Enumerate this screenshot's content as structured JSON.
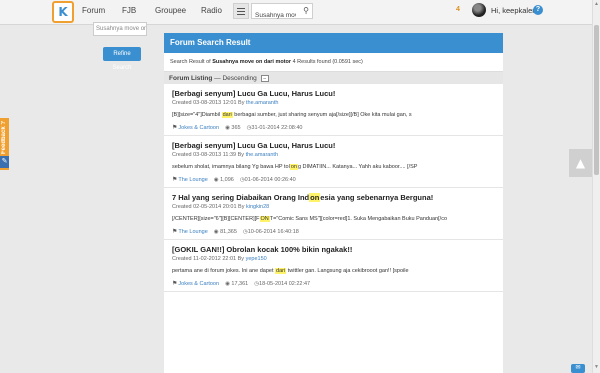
{
  "nav": {
    "logo_glyph": "K",
    "items": [
      "Forum",
      "FJB",
      "Groupee",
      "Radio"
    ],
    "search_value": "Susahnya move",
    "notif_count": "4",
    "greeting": "Hi, keepkalem",
    "help_glyph": "?"
  },
  "refine": {
    "input_value": "Susahnya move on d",
    "button_label": "Refine Search"
  },
  "feedback_label": "Feedback ?",
  "result": {
    "header": "Forum Search Result",
    "info_prefix": "Search Result of ",
    "query": "Susahnya move on dari motor",
    "info_suffix": " 4 Results found (0.0591 sec)",
    "listing_label": "Forum Listing",
    "listing_order": " — Descending"
  },
  "threads": [
    {
      "title": "[Berbagi senyum] Lucu Ga Lucu, Harus Lucu!",
      "created": "Created 03-08-2013 12:01 By ",
      "author": "the.amaranth",
      "snippet_pre": "[B][size=\"4\"]Diambil ",
      "snippet_hl": "dari",
      "snippet_post": " berbagai sumber, just sharing senyum aja[/size][/B] Oke kita mulai gan, s",
      "forum": "Jokes & Cartoon",
      "views": "365",
      "last": "31-01-2014 22:08:40"
    },
    {
      "title": "[Berbagi senyum] Lucu Ga Lucu, Harus Lucu!",
      "created": "Created 03-08-2013 11:39 By ",
      "author": "the.amaranth",
      "snippet_pre": "sebelum sholat, imamnya bilang Yg bawa HP tol",
      "snippet_hl": "on",
      "snippet_post": "g DIMATIIN... Katanya... Yahh aku kaboor.... [/SP",
      "forum": "The Lounge",
      "views": "1,096",
      "last": "01-06-2014 00:26:40"
    },
    {
      "title": "7 Hal yang sering Diabaikan Orang Ind",
      "title_hl": "on",
      "title_post": "esia yang sebenarnya Berguna!",
      "created": "Created 02-05-2014 20:01 By ",
      "author": "kingkin28",
      "snippet_pre": "[/CENTER][size=\"6\"][B][CENTER][F",
      "snippet_hl": "ON",
      "snippet_post": "T=\"Comic Sans MS\"][color=red]1. Suka Mengabaikan Buku Panduan[/co",
      "forum": "The Lounge",
      "views": "81,365",
      "last": "10-06-2014 16:40:18"
    },
    {
      "title": "[GOKIL GAN!!] Obrolan kocak 100% bikin ngakak!!",
      "created": "Created 11-02-2012 22:01 By ",
      "author": "yepe150",
      "snippet_pre": "pertama ane di forum jokes. Ini ane dapet ",
      "snippet_hl": "dari",
      "snippet_post": " twittler gan. Langsung aja cekibrooot gan!! [spoile",
      "forum": "Jokes & Cartoon",
      "views": "17,361",
      "last": "18-05-2014 02:22:47"
    }
  ],
  "colors": {
    "accent": "#3a8fd0",
    "highlight": "#fff36a",
    "feedback": "#f0a030"
  },
  "icons": [
    "logo-icon",
    "menu-icon",
    "search-icon",
    "help-icon",
    "tag-icon",
    "eye-icon",
    "clock-icon",
    "back-to-top-icon"
  ]
}
